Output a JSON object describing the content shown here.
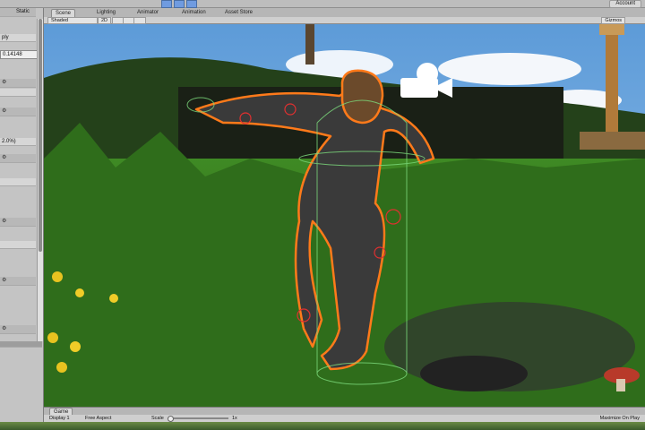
{
  "inspector": {
    "static_label": "Static",
    "rows": [
      {
        "text": "ply"
      },
      {
        "text": "0.14148"
      },
      {
        "text": ""
      },
      {
        "text": ""
      },
      {
        "text": "2.0%)"
      }
    ]
  },
  "scene": {
    "tabs": [
      {
        "label": "Scene",
        "active": true
      },
      {
        "label": "Lighting"
      },
      {
        "label": "Animator"
      },
      {
        "label": "Animation"
      },
      {
        "label": "Asset Store"
      }
    ],
    "shading_mode": "Shaded",
    "view_2d": "2D",
    "gizmos_label": "Gizmos"
  },
  "account": {
    "label": "Account"
  },
  "game": {
    "tab_label": "Game",
    "display": "Display 1",
    "aspect": "Free Aspect",
    "scale_label": "Scale",
    "scale_value": "1x",
    "maximize_label": "Maximize On Play"
  },
  "colors": {
    "sky": "#7fb2e0",
    "grass": "#2f7a1f",
    "selection_outline": "#ff7a1a",
    "bounds_lines": "#7ddc7d"
  },
  "icons": [
    "gear-icon",
    "camera-icon",
    "move-tool-icon",
    "rotate-tool-icon",
    "scale-tool-icon"
  ]
}
